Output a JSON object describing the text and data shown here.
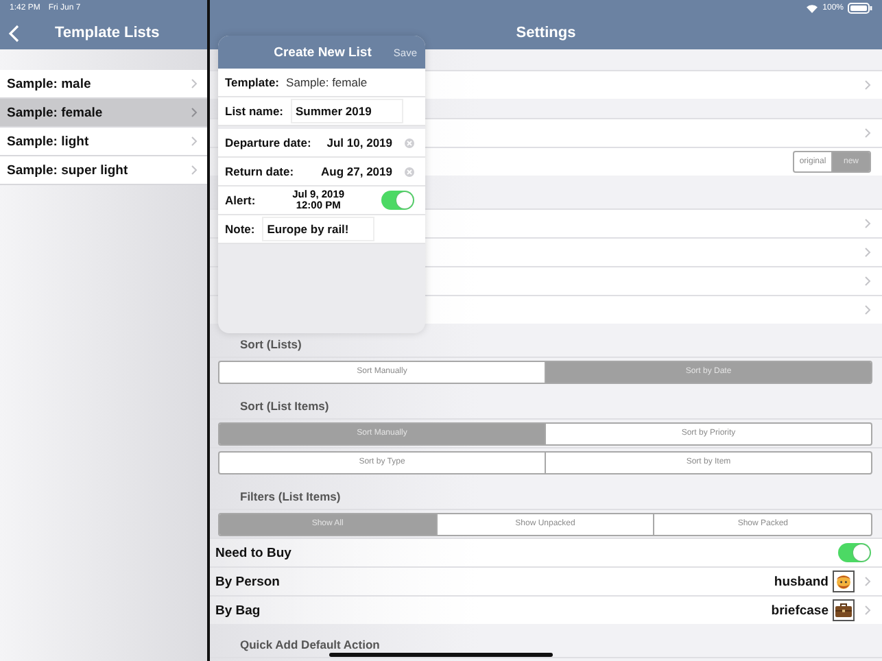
{
  "status_bar": {
    "time": "1:42 PM",
    "date": "Fri Jun 7",
    "battery": "100%"
  },
  "sidebar": {
    "title": "Template Lists",
    "items": [
      {
        "label": "Sample: male",
        "selected": false
      },
      {
        "label": "Sample: female",
        "selected": true
      },
      {
        "label": "Sample: light",
        "selected": false
      },
      {
        "label": "Sample: super light",
        "selected": false
      }
    ]
  },
  "settings": {
    "title": "Settings",
    "top_rows": [
      {
        "kind": "chevron"
      },
      {
        "kind": "gap"
      },
      {
        "kind": "chevron"
      },
      {
        "kind": "segmented",
        "options": [
          {
            "label": "original",
            "selected": false
          },
          {
            "label": "new",
            "selected": true
          }
        ]
      },
      {
        "kind": "tall_gap"
      },
      {
        "kind": "chevron"
      },
      {
        "kind": "chevron"
      },
      {
        "kind": "chevron"
      },
      {
        "kind": "chevron"
      }
    ],
    "sections": [
      {
        "title": "Sort (Lists)",
        "controls": [
          [
            {
              "label": "Sort Manually",
              "selected": false
            },
            {
              "label": "Sort by Date",
              "selected": true
            }
          ]
        ]
      },
      {
        "title": "Sort (List Items)",
        "controls": [
          [
            {
              "label": "Sort Manually",
              "selected": true
            },
            {
              "label": "Sort by Priority",
              "selected": false
            }
          ],
          [
            {
              "label": "Sort by Type",
              "selected": false
            },
            {
              "label": "Sort by Item",
              "selected": false
            }
          ]
        ]
      },
      {
        "title": "Filters (List Items)",
        "controls": [
          [
            {
              "label": "Show All",
              "selected": true
            },
            {
              "label": "Show Unpacked",
              "selected": false
            },
            {
              "label": "Show Packed",
              "selected": false
            }
          ]
        ]
      }
    ],
    "filter_rows": [
      {
        "kind": "toggle",
        "label": "Need to Buy",
        "on": true
      },
      {
        "kind": "person",
        "label": "By Person",
        "value": "husband"
      },
      {
        "kind": "bag",
        "label": "By Bag",
        "value": "briefcase"
      }
    ],
    "last_section": {
      "title": "Quick Add Default Action"
    }
  },
  "popover": {
    "title": "Create New List",
    "save": "Save",
    "fields": [
      {
        "kind": "text",
        "label": "Template:",
        "value": "Sample: female"
      },
      {
        "kind": "input",
        "label": "List name:",
        "value": "Summer 2019"
      },
      {
        "kind": "date",
        "label": "Departure date:",
        "value": "Jul 10, 2019"
      },
      {
        "kind": "date",
        "label": "Return date:",
        "value": "Aug 27, 2019"
      },
      {
        "kind": "alert",
        "label": "Alert:",
        "date": "Jul 9, 2019",
        "time": "12:00 PM",
        "on": true
      },
      {
        "kind": "input",
        "label": "Note:",
        "value": "Europe by rail!"
      }
    ]
  }
}
